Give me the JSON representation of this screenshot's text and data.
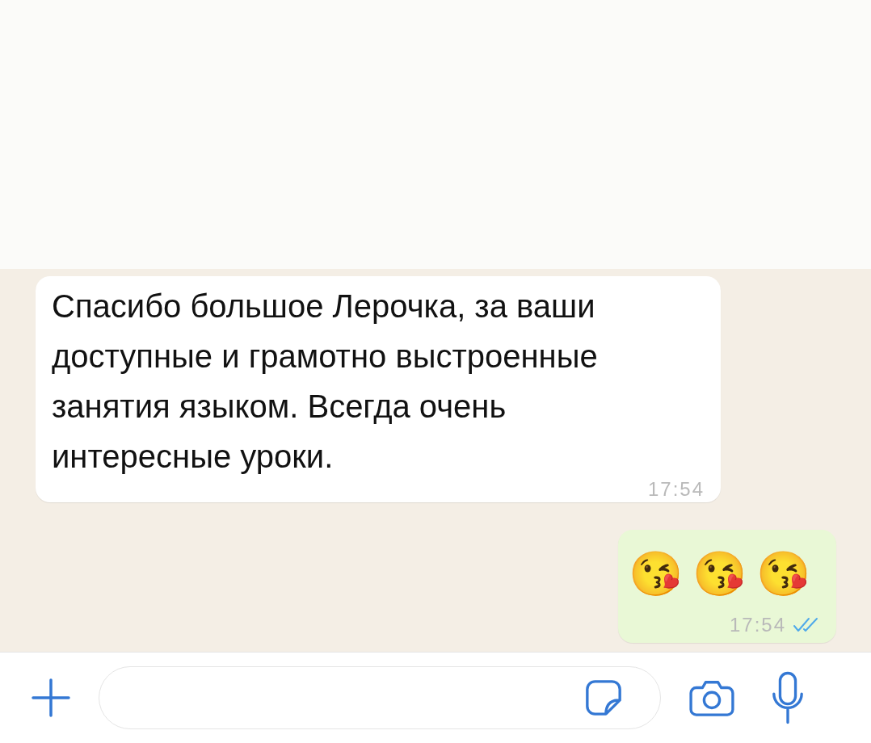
{
  "messages": [
    {
      "kind": "text",
      "text": "Спасибо большое Лерочка, за ваши доступные и грамотно выстроенные занятия языком. Всегда очень интересные уроки.",
      "time": "17:54"
    },
    {
      "kind": "emoji",
      "text": "😘😘😘",
      "time": "17:54",
      "read": true
    }
  ]
}
